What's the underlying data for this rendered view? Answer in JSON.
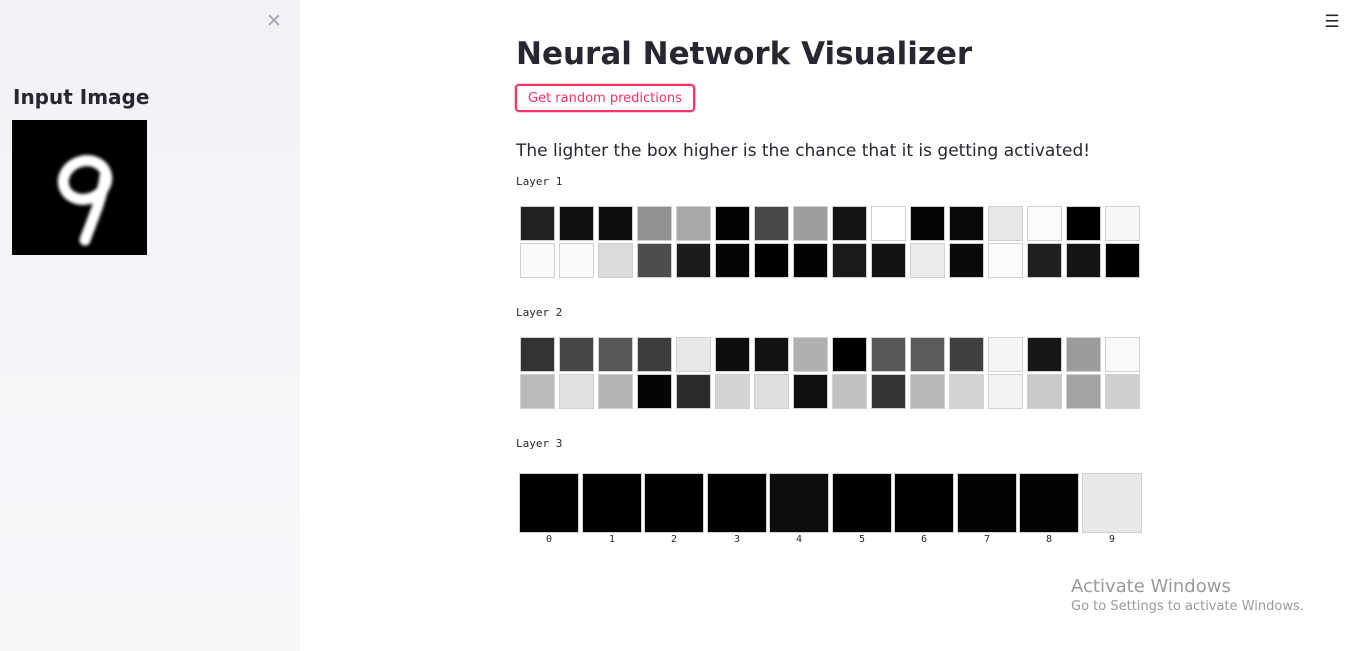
{
  "sidebar": {
    "close_icon": "close-icon",
    "title": "Input Image",
    "input_digit": "9"
  },
  "menu_icon": "hamburger-menu-icon",
  "main": {
    "title": "Neural Network Visualizer",
    "button_label": "Get random predictions",
    "subtitle": "The lighter the box higher is the chance that it is getting activated!"
  },
  "colors": {
    "accent": "#f63366",
    "sidebar_bg": "#f0f2f6",
    "text": "#262730"
  },
  "layers": [
    {
      "label": "Layer 1",
      "rows": [
        [
          0.13,
          0.06,
          0.05,
          0.57,
          0.66,
          0.01,
          0.28,
          0.62,
          0.08,
          1.0,
          0.02,
          0.03,
          0.91,
          0.99,
          0.0,
          0.97
        ],
        [
          0.98,
          0.98,
          0.86,
          0.3,
          0.11,
          0.02,
          0.0,
          0.01,
          0.1,
          0.07,
          0.92,
          0.04,
          0.99,
          0.12,
          0.08,
          0.0
        ]
      ]
    },
    {
      "label": "Layer 2",
      "rows": [
        [
          0.2,
          0.27,
          0.34,
          0.24,
          0.91,
          0.05,
          0.07,
          0.69,
          0.0,
          0.34,
          0.36,
          0.25,
          0.96,
          0.09,
          0.61,
          0.98
        ],
        [
          0.73,
          0.88,
          0.7,
          0.02,
          0.17,
          0.83,
          0.87,
          0.06,
          0.76,
          0.2,
          0.72,
          0.83,
          0.95,
          0.79,
          0.64,
          0.81
        ]
      ]
    }
  ],
  "output_layer": {
    "label": "Layer 3",
    "classes": [
      "0",
      "1",
      "2",
      "3",
      "4",
      "5",
      "6",
      "7",
      "8",
      "9"
    ],
    "activations": [
      0.0,
      0.0,
      0.0,
      0.0,
      0.05,
      0.0,
      0.0,
      0.01,
      0.01,
      0.91
    ]
  },
  "watermark": {
    "title": "Activate Windows",
    "subtitle": "Go to Settings to activate Windows."
  }
}
